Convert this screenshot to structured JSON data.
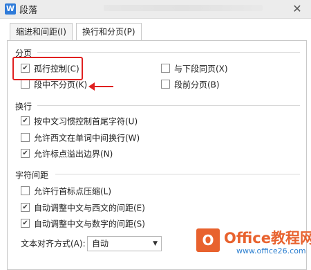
{
  "window": {
    "title": "段落",
    "close_label": "✕",
    "app_icon": "W"
  },
  "tabs": [
    {
      "label": "缩进和间距(I)",
      "active": false
    },
    {
      "label": "换行和分页(P)",
      "active": true
    }
  ],
  "sections": {
    "pagination": {
      "title": "分页",
      "options": [
        {
          "label": "孤行控制(C)",
          "checked": true
        },
        {
          "label": "与下段同页(X)",
          "checked": false
        },
        {
          "label": "段中不分页(K)",
          "checked": false
        },
        {
          "label": "段前分页(B)",
          "checked": false
        }
      ]
    },
    "line_break": {
      "title": "换行",
      "options": [
        {
          "label": "按中文习惯控制首尾字符(U)",
          "checked": true
        },
        {
          "label": "允许西文在单词中间换行(W)",
          "checked": false
        },
        {
          "label": "允许标点溢出边界(N)",
          "checked": true
        }
      ]
    },
    "char_spacing": {
      "title": "字符间距",
      "options": [
        {
          "label": "允许行首标点压缩(L)",
          "checked": false
        },
        {
          "label": "自动调整中文与西文的间距(E)",
          "checked": true
        },
        {
          "label": "自动调整中文与数字的间距(S)",
          "checked": true
        }
      ]
    }
  },
  "text_alignment": {
    "label": "文本对齐方式(A):",
    "value": "自动"
  },
  "watermark": {
    "logo": "O",
    "text": "Office教程网",
    "sub": "www.office26.com"
  },
  "colors": {
    "highlight": "#e02020",
    "watermark": "#e8622e",
    "accent": "#2f7bd9"
  }
}
